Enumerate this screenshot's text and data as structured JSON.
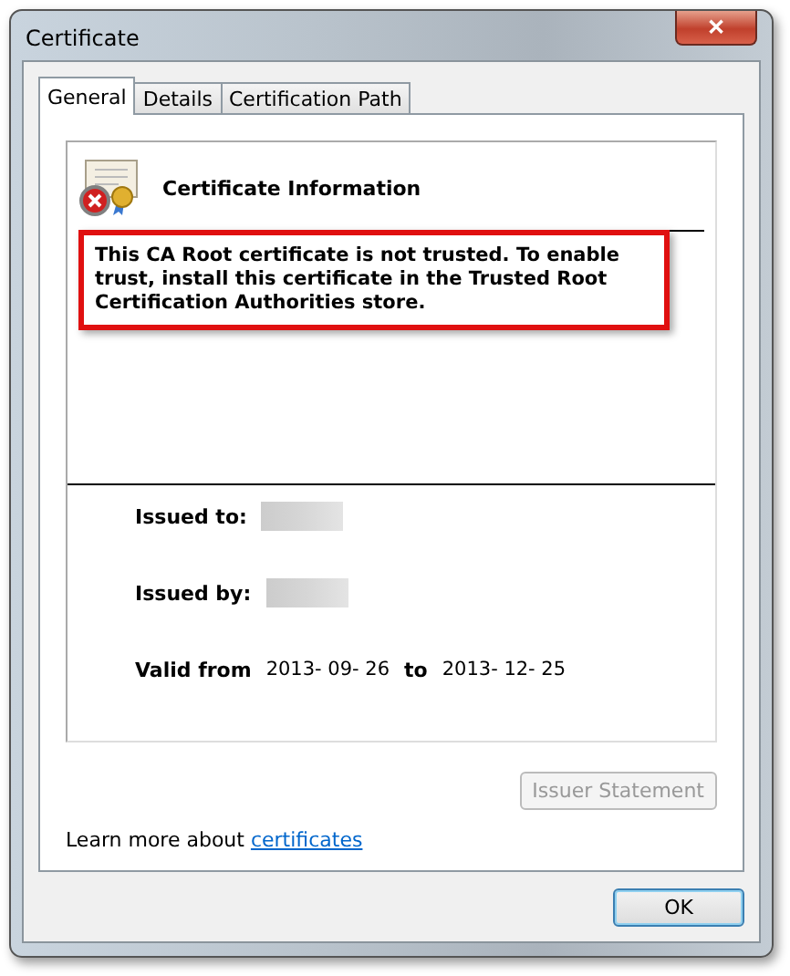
{
  "window": {
    "title": "Certificate",
    "close": "✕"
  },
  "tabs": [
    {
      "label": "General",
      "selected": true
    },
    {
      "label": "Details",
      "selected": false
    },
    {
      "label": "Certification Path",
      "selected": false
    }
  ],
  "info": {
    "heading": "Certificate Information",
    "message": "This CA Root certificate is not trusted. To enable trust, install this certificate in the Trusted Root Certification Authorities store.",
    "highlighted": true,
    "issued_to_label": "Issued to:",
    "issued_by_label": "Issued by:",
    "valid_from_label": "Valid from",
    "valid_from": "2013- 09- 26",
    "to_label": "to",
    "valid_to": "2013- 12- 25"
  },
  "issuer_button": {
    "label": "Issuer Statement",
    "disabled": true
  },
  "learn_more": {
    "text": "Learn more about ",
    "link": "certificates"
  },
  "ok_button": {
    "label": "OK"
  }
}
